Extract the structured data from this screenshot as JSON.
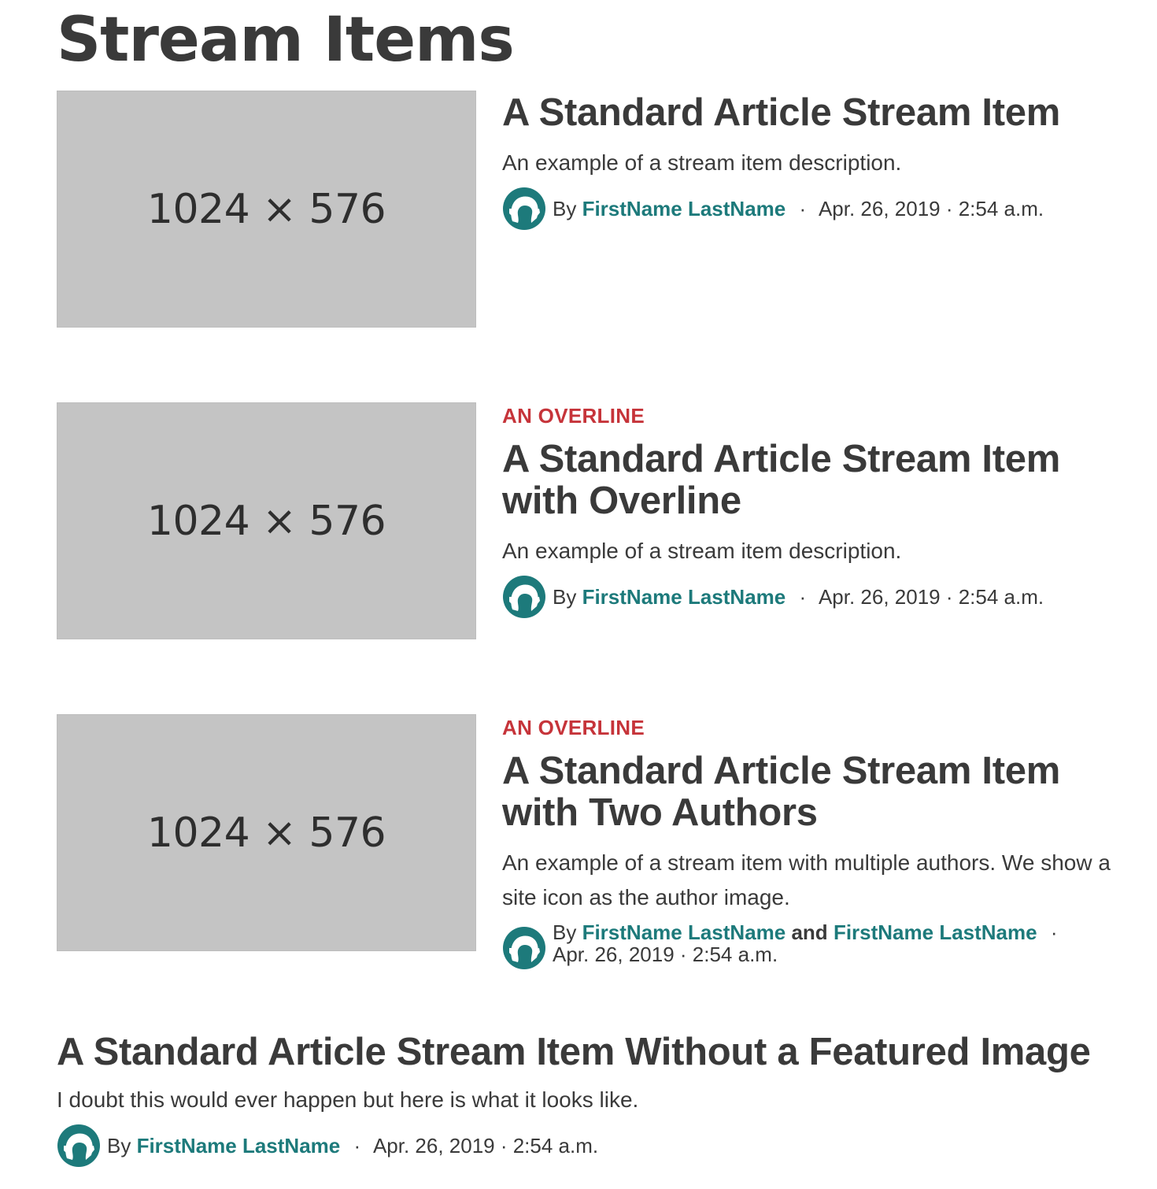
{
  "page": {
    "title": "Stream Items"
  },
  "colors": {
    "link": "#1d7a7b",
    "overline": "#c6343a",
    "placeholder": "#c4c4c4",
    "text": "#3a3a3a"
  },
  "items": [
    {
      "image_label": "1024 × 576",
      "overline": "",
      "headline": "A Standard Article Stream Item",
      "description": "An example of a stream item description.",
      "by": "By",
      "authors": [
        "FirstName LastName"
      ],
      "date": "Apr. 26, 2019 · 2:54 a.m.",
      "avatar_icon": "site-avatar-icon"
    },
    {
      "image_label": "1024 × 576",
      "overline": "AN OVERLINE",
      "headline": "A Standard Article Stream Item with Overline",
      "description": "An example of a stream item description.",
      "by": "By",
      "authors": [
        "FirstName LastName"
      ],
      "date": "Apr. 26, 2019 · 2:54 a.m.",
      "avatar_icon": "site-avatar-icon"
    },
    {
      "image_label": "1024 × 576",
      "overline": "AN OVERLINE",
      "headline": "A Standard Article Stream Item with Two Authors",
      "description": "An example of a stream item with multiple authors. We show a site icon as the author image.",
      "by": "By",
      "authors": [
        "FirstName LastName",
        "FirstName LastName"
      ],
      "author_joiner": "and",
      "date": "Apr. 26, 2019 · 2:54 a.m.",
      "avatar_icon": "site-avatar-icon"
    },
    {
      "overline": "",
      "headline": "A Standard Article Stream Item Without a Featured Image",
      "description": "I doubt this would ever happen but here is what it looks like.",
      "by": "By",
      "authors": [
        "FirstName LastName"
      ],
      "date": "Apr. 26, 2019 · 2:54 a.m.",
      "avatar_icon": "site-avatar-icon"
    }
  ],
  "separator": "·"
}
